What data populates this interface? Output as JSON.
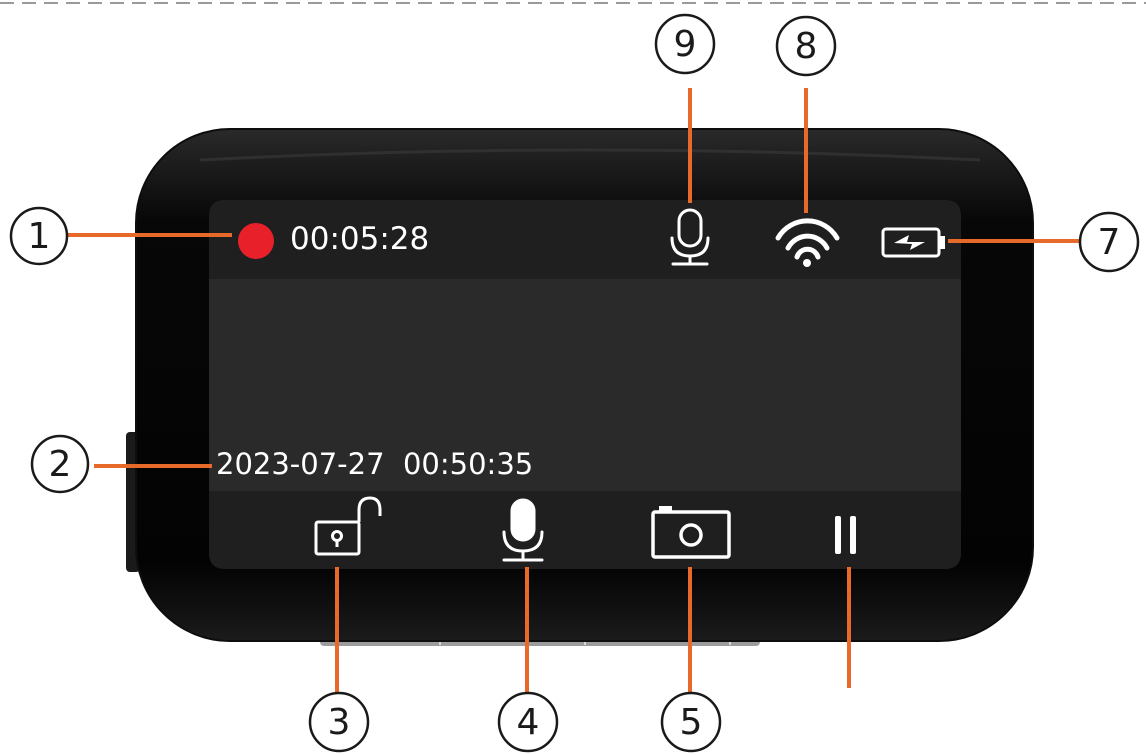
{
  "screen": {
    "recording_time": "00:05:28",
    "date_time": "2023-07-27  00:50:35"
  },
  "status_icons": [
    "recording-dot-icon",
    "microphone-icon",
    "wifi-icon",
    "battery-charging-icon"
  ],
  "toolbar_icons": [
    "lock-icon",
    "microphone-icon",
    "camera-icon",
    "pause-icon"
  ],
  "callouts": [
    "1",
    "2",
    "3",
    "4",
    "5",
    "7",
    "8",
    "9"
  ],
  "colors": {
    "recording": "#e8202a",
    "leader_line": "#e86a2a",
    "screen_bg": "#2a2a2a",
    "status_bar": "#1f1f1f",
    "bezel": "#050505",
    "icon": "#ffffff"
  }
}
